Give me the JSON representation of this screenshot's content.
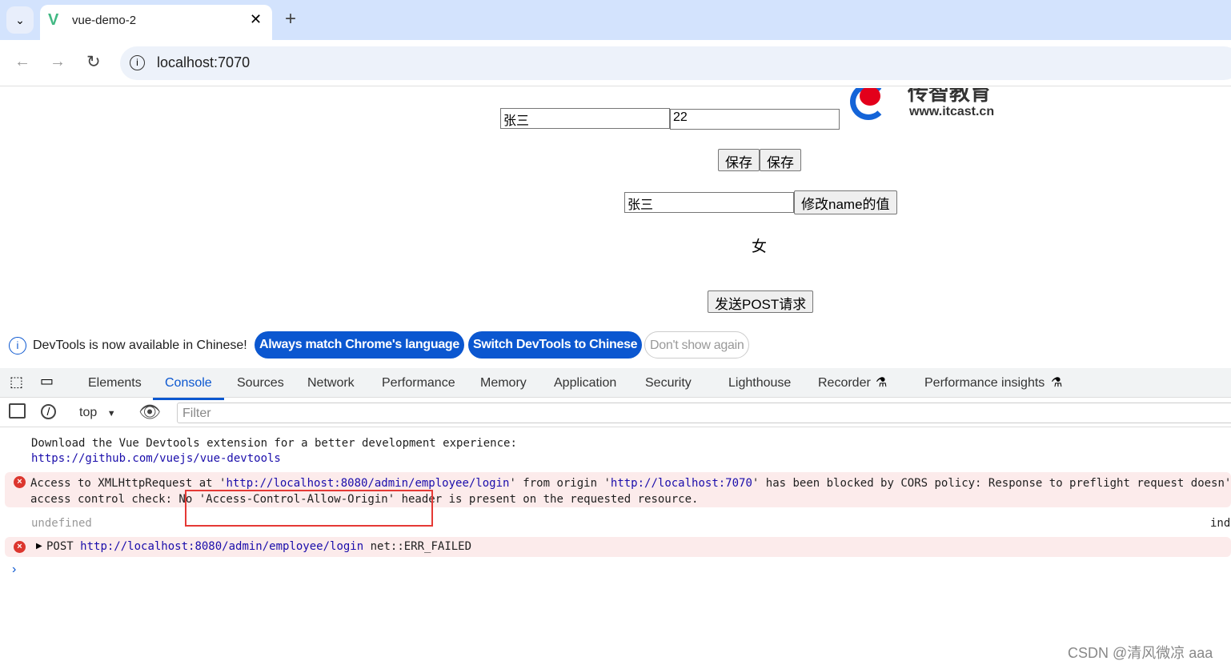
{
  "browser": {
    "tab_title": "vue-demo-2",
    "url": "localhost:7070"
  },
  "page": {
    "logo_text": "传智教育",
    "logo_url": "www.itcast.cn",
    "name_input": "张三",
    "age_input": "22",
    "save1": "保存",
    "save2": "保存",
    "name_input2": "张三",
    "change_name": "修改name的值",
    "gender": "女",
    "post_button": "发送POST请求"
  },
  "banner": {
    "text": "DevTools is now available in Chinese!",
    "btn1": "Always match Chrome's language",
    "btn2": "Switch DevTools to Chinese",
    "btn3": "Don't show again"
  },
  "devtools": {
    "tabs": [
      "Elements",
      "Console",
      "Sources",
      "Network",
      "Performance",
      "Memory",
      "Application",
      "Security",
      "Lighthouse",
      "Recorder",
      "Performance insights"
    ],
    "active_tab": "Console",
    "context": "top",
    "filter_placeholder": "Filter"
  },
  "console": {
    "msg1": "Download the Vue Devtools extension for a better development experience:",
    "msg1_link": "https://github.com/vuejs/vue-devtools",
    "err1_a": "Access to XMLHttpRequest at '",
    "err1_link1": "http://localhost:8080/admin/employee/login",
    "err1_b": "' from origin '",
    "err1_link2": "http://localhost:7070",
    "err1_c": "' has been blocked by CORS policy: Response to preflight request doesn't pass",
    "err1_d": "access control check: No 'Access-Control-Allow-Origin' header is present on the requested resource.",
    "undefined": "undefined",
    "source_link": "ind",
    "err2_a": "POST ",
    "err2_link": "http://localhost:8080/admin/employee/login",
    "err2_b": " net::ERR_FAILED"
  },
  "watermark": "CSDN @清风微凉 aaa",
  "colors": {
    "accent": "#0b57d0",
    "error_bg": "#fcebeb",
    "highlight_box": "#e53935"
  }
}
